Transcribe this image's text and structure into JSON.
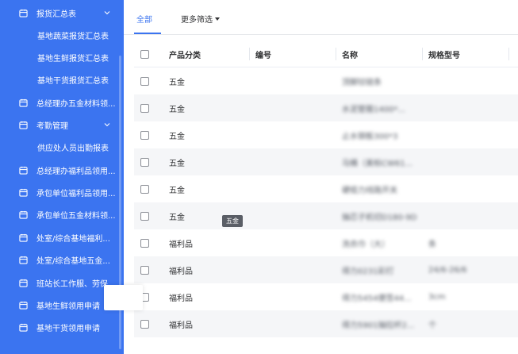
{
  "sidebar": {
    "items": [
      {
        "type": "group",
        "label": "报货汇总表",
        "icon": "calendar-icon",
        "expanded": true
      },
      {
        "type": "sub",
        "label": "基地蔬菜报货汇总表"
      },
      {
        "type": "sub",
        "label": "基地生鲜报货汇总表"
      },
      {
        "type": "sub",
        "label": "基地干货报货汇总表"
      },
      {
        "type": "item",
        "label": "总经理办五金材料领...",
        "icon": "calendar-icon"
      },
      {
        "type": "group",
        "label": "考勤管理",
        "icon": "calendar-icon",
        "expanded": true
      },
      {
        "type": "sub",
        "label": "供应处人员出勤报表"
      },
      {
        "type": "item",
        "label": "总经理办福利品领用...",
        "icon": "calendar-icon"
      },
      {
        "type": "item",
        "label": "承包单位福利品领用...",
        "icon": "calendar-icon"
      },
      {
        "type": "item",
        "label": "承包单位五金材料领...",
        "icon": "calendar-icon"
      },
      {
        "type": "item",
        "label": "处室/综合基地福利...",
        "icon": "calendar-icon"
      },
      {
        "type": "item",
        "label": "处室/综合基地五金...",
        "icon": "calendar-icon"
      },
      {
        "type": "item",
        "label": "班站长工作服、劳保...",
        "icon": "calendar-icon"
      },
      {
        "type": "item",
        "label": "基地生鲜领用申请",
        "icon": "calendar-icon"
      },
      {
        "type": "item",
        "label": "基地干货领用申请",
        "icon": "calendar-icon"
      }
    ]
  },
  "tabs": {
    "all": "全部",
    "more_filter": "更多筛选"
  },
  "table": {
    "columns": [
      "产品分类",
      "编号",
      "名称",
      "规格型号"
    ],
    "rows": [
      {
        "category": "五金",
        "code": "",
        "name": "顶脚铰链条",
        "spec": ""
      },
      {
        "category": "五金",
        "code": "",
        "name": "水泥管箍1400*...",
        "spec": ""
      },
      {
        "category": "五金",
        "code": "",
        "name": "止水钢板300*3",
        "spec": ""
      },
      {
        "category": "五金",
        "code": "",
        "name": "马桶（美标CW61...",
        "spec": ""
      },
      {
        "category": "五金",
        "code": "",
        "name": "硬缆力线路开关",
        "spec": ""
      },
      {
        "category": "五金",
        "code": "",
        "name": "抽芯子机切D180-9D",
        "spec": ""
      },
      {
        "category": "福利品",
        "code": "",
        "name": "洗衣巾（大）",
        "spec": "条"
      },
      {
        "category": "福利品",
        "code": "",
        "name": "得力0231彩打",
        "spec": "24/6-26/6"
      },
      {
        "category": "福利品",
        "code": "",
        "name": "得力5454便签44...",
        "spec": "3cm"
      },
      {
        "category": "福利品",
        "code": "",
        "name": "得力5901抽拉杆2...",
        "spec": "个"
      }
    ]
  },
  "tooltip": {
    "text": "五金"
  },
  "colors": {
    "sidebar": "#3b74f0",
    "accent": "#3b74f0",
    "stripe": "#f5f6f8"
  }
}
